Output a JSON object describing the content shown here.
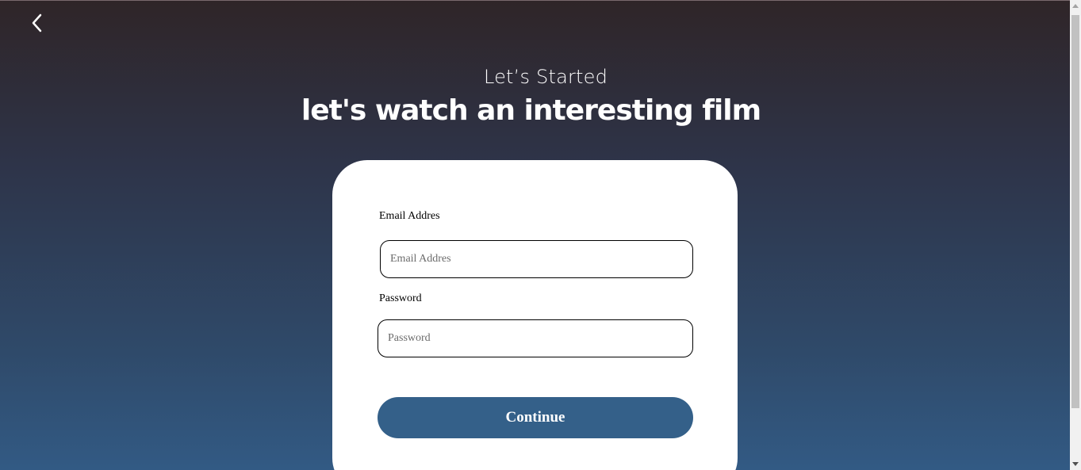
{
  "header": {
    "back_icon": "chevron-left-icon",
    "subtitle": "Let’s Started",
    "headline": "let's watch an interesting film"
  },
  "form": {
    "email_label": "Email Addres",
    "email_placeholder": "Email Addres",
    "email_value": "",
    "password_label": "Password",
    "password_placeholder": "Password",
    "password_value": "",
    "submit_label": "Continue"
  },
  "colors": {
    "background_top": "#2f2528",
    "background_bottom": "#325a84",
    "card": "#ffffff",
    "button": "#346089",
    "button_text": "#ffffff"
  }
}
